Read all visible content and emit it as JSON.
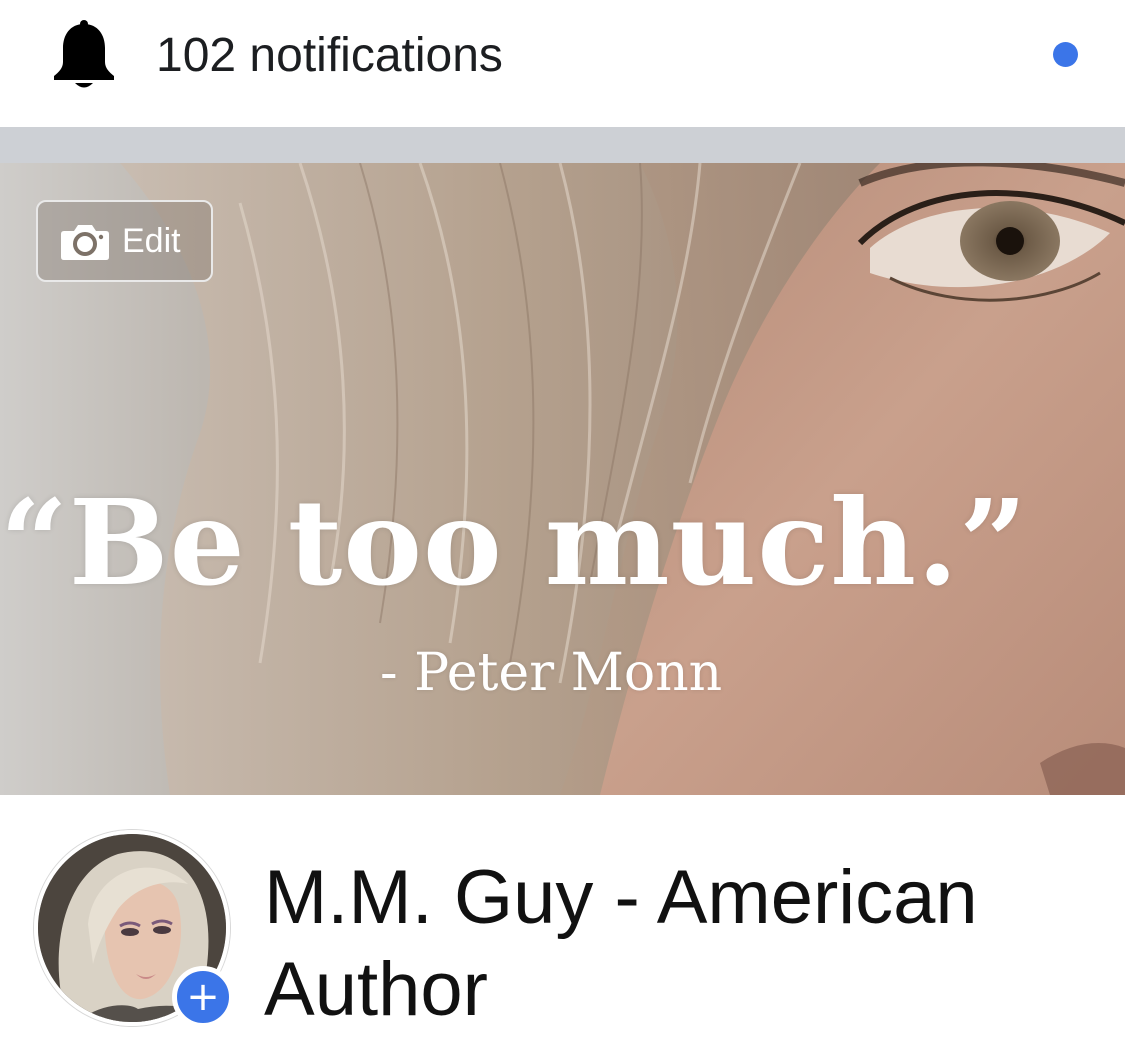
{
  "notifications": {
    "text": "102 notifications",
    "icon": "bell-icon",
    "unread_dot_color": "#3b75e8"
  },
  "cover": {
    "edit_label": "Edit",
    "edit_icon": "camera-icon",
    "quote": "“Be too much.”",
    "quote_author": "- Peter Monn"
  },
  "profile": {
    "name": "M.M. Guy - American Author",
    "add_photo_symbol": "+",
    "accent_color": "#3b75e8"
  }
}
